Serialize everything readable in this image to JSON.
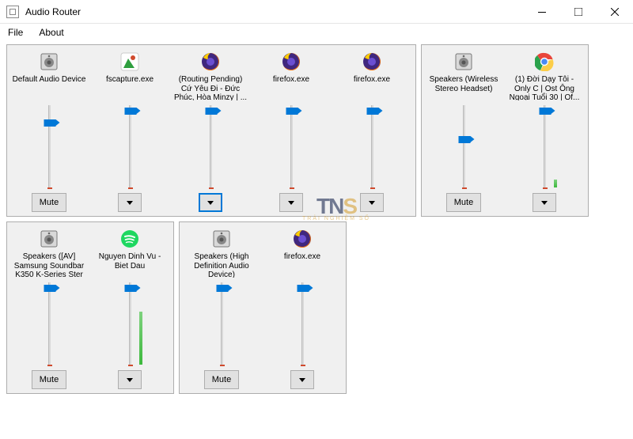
{
  "window": {
    "title": "Audio Router"
  },
  "menu": {
    "file": "File",
    "about": "About"
  },
  "labels": {
    "mute": "Mute"
  },
  "panels": [
    {
      "id": "panel-1",
      "columns": [
        {
          "id": "default-audio",
          "icon": "speaker",
          "label": "Default Audio Device",
          "volume": 78,
          "meter": 0,
          "button": "mute"
        },
        {
          "id": "fscapture",
          "icon": "fscapture",
          "label": "fscapture.exe",
          "volume": 92,
          "meter": 0,
          "button": "dropdown"
        },
        {
          "id": "ff-routing",
          "icon": "firefox",
          "label": "(Routing Pending) Cứ Yêu Đi - Đức Phúc, Hòa Minzy | ...",
          "volume": 92,
          "meter": 0,
          "button": "dropdown",
          "selected": true
        },
        {
          "id": "ff-1",
          "icon": "firefox",
          "label": "firefox.exe",
          "volume": 92,
          "meter": 0,
          "button": "dropdown"
        },
        {
          "id": "ff-2",
          "icon": "firefox",
          "label": "firefox.exe",
          "volume": 92,
          "meter": 0,
          "button": "dropdown"
        }
      ]
    },
    {
      "id": "panel-2",
      "columns": [
        {
          "id": "speakers-wireless",
          "icon": "speaker",
          "label": "Speakers (Wireless Stereo Headset)",
          "volume": 58,
          "meter": 0,
          "button": "mute"
        },
        {
          "id": "chrome-doi-day",
          "icon": "chrome",
          "label": "(1) Đời Dạy Tôi - Only C | Ost Ông Ngoại Tuổi 30 | Of...",
          "volume": 92,
          "meter": 9,
          "button": "dropdown"
        }
      ]
    },
    {
      "id": "panel-3",
      "columns": [
        {
          "id": "speakers-av",
          "icon": "speaker",
          "label": "Speakers ([AV] Samsung Soundbar K350 K-Series Ster",
          "volume": 92,
          "meter": 0,
          "button": "mute"
        },
        {
          "id": "spotify-nguyen",
          "icon": "spotify",
          "label": "Nguyen Dinh Vu - Biet Dau",
          "volume": 92,
          "meter": 58,
          "button": "dropdown"
        }
      ]
    },
    {
      "id": "panel-4",
      "columns": [
        {
          "id": "speakers-hd",
          "icon": "speaker",
          "label": "Speakers (High Definition Audio Device)",
          "volume": 92,
          "meter": 0,
          "button": "mute"
        },
        {
          "id": "ff-3",
          "icon": "firefox",
          "label": "firefox.exe",
          "volume": 92,
          "meter": 0,
          "button": "dropdown"
        }
      ]
    }
  ],
  "watermark": {
    "brand": "TNS",
    "sub": "TRẢI NGHIỆM SỐ"
  }
}
